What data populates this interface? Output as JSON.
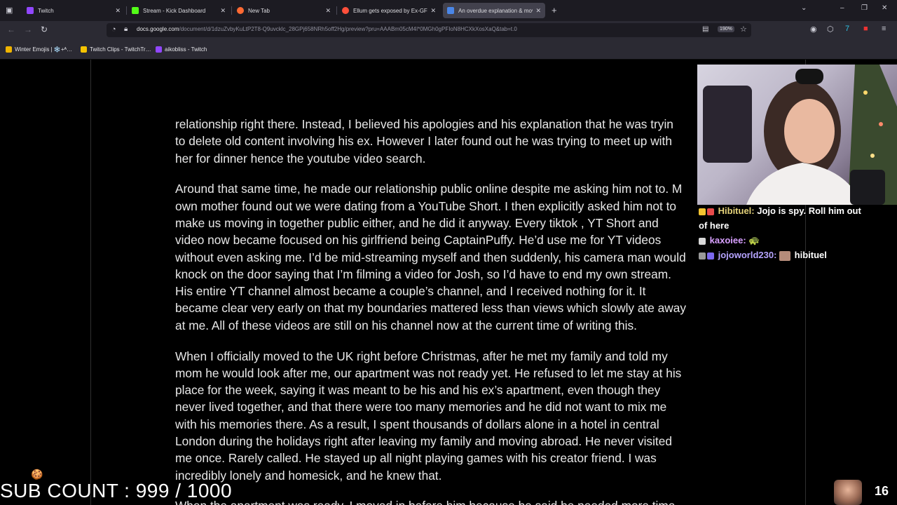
{
  "browser": {
    "tabs": [
      {
        "label": "Twitch",
        "fav": "#9147ff"
      },
      {
        "label": "Stream - Kick Dashboard",
        "fav": "#53fc18"
      },
      {
        "label": "New Tab",
        "fav": "#ff6a33"
      },
      {
        "label": "Ellum gets exposed by Ex-GF Ca",
        "fav": "#ff4f3b"
      },
      {
        "label": "An overdue explanation & mov",
        "fav": "#4a86e8"
      }
    ],
    "url_domain": "docs.google.com",
    "url_path": "/document/d/1dzuZvbyKuLtP2T8-Q9uvcklc_28GPj658NRh5off2Hg/preview?pru=AAABm05cM4I*0MGh0gPFIoN8HCXkXosXaQ&tab=t.0",
    "zoom": "190%",
    "bookmarks": [
      {
        "label": "Winter Emojis | ❄️+ᴬ…",
        "color": "#f0b400"
      },
      {
        "label": "Twitch Clips - TwitchTr…",
        "color": "#f5c400"
      },
      {
        "label": "aikobliss - Twitch",
        "color": "#9147ff"
      }
    ]
  },
  "document": {
    "paragraphs": [
      [
        "relationship right there. Instead, I believed his apologies and his explanation that he was tryin",
        "to delete old content involving his ex. However I later found out he was trying to meet up with",
        "her for dinner hence the youtube video search."
      ],
      [
        "Around that same time, he made our relationship public online despite me asking him not to. M",
        "own mother found out we were dating from a YouTube Short. I then explicitly asked him not to",
        "make us moving in together public either, and he did it anyway. Every tiktok , YT Short and",
        "video now became focused on his girlfriend being CaptainPuffy. He’d use me for YT videos",
        "without even asking me. I’d be mid-streaming myself and then suddenly, his camera man would",
        "knock on the door saying that I’m filming a video for Josh, so I’d have to end my own stream.",
        "His entire YT channel almost became a couple’s channel, and I received nothing for it. It",
        "became clear very early on that my boundaries mattered less than views which slowly ate away",
        "at me. All of these videos are still on his channel now at the current time of writing this."
      ],
      [
        "When I officially moved to the UK right before Christmas, after he met my family and told my",
        "mom he would look after me, our apartment was not ready yet. He refused to let me stay at his",
        "place for the week, saying it was meant to be his and his ex’s apartment, even though they",
        "never lived together, and that there were too many memories and he did not want to mix me",
        "with his memories there. As a result, I spent thousands of dollars alone in a hotel in central",
        "London during the holidays right after leaving my family and moving abroad. He never visited",
        "me once. Rarely called. He stayed up all night playing games with his creator friend. I was",
        "incredibly lonely and homesick, and he knew that."
      ],
      [
        "When the apartment was ready, I moved in before him because he said he needed more time"
      ]
    ]
  },
  "overlay": {
    "chat": [
      {
        "user": "Hibituel:",
        "message": "Jojo is spy. Roll him out",
        "message2": "of here"
      },
      {
        "user": "kaxoiee:",
        "message": "🐢"
      },
      {
        "user": "jojoworld230:",
        "message": "hibituel"
      }
    ],
    "sub_count": "SUB COUNT : 999 / 1000",
    "viewers": "16"
  }
}
